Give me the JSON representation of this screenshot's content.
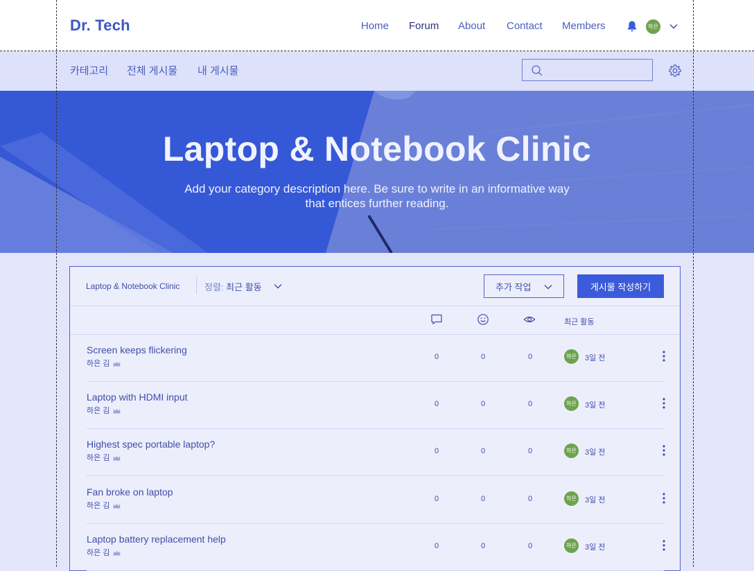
{
  "header": {
    "logo": "Dr. Tech",
    "nav": [
      "Home",
      "Forum",
      "About",
      "Contact",
      "Members"
    ],
    "avatar_text": "하은",
    "icons": [
      "bell-icon",
      "chevron-down-icon"
    ]
  },
  "subnav": {
    "items": [
      "카테고리",
      "전체 게시물",
      "내 게시물"
    ],
    "search_placeholder": ""
  },
  "hero": {
    "title": "Laptop & Notebook Clinic",
    "description_line1": "Add your category description here. Be sure to write in an informative way",
    "description_line2": "that entices further reading."
  },
  "toolbar": {
    "breadcrumb": "Laptop & Notebook Clinic",
    "sort_label": "정렬:",
    "sort_value": "최근 활동",
    "more_actions": "추가 작업",
    "new_post": "게시물 작성하기"
  },
  "columns": {
    "icons": [
      "comment-icon",
      "like-icon",
      "view-icon"
    ],
    "recent": "최근 활동"
  },
  "posts": [
    {
      "title": "Screen keeps flickering",
      "author": "하은 김",
      "comments": "0",
      "likes": "0",
      "views": "0",
      "avatar": "하은",
      "time": "3일 전"
    },
    {
      "title": "Laptop with HDMI input",
      "author": "하은 김",
      "comments": "0",
      "likes": "0",
      "views": "0",
      "avatar": "하은",
      "time": "3일 전"
    },
    {
      "title": "Highest spec portable laptop?",
      "author": "하은 김",
      "comments": "0",
      "likes": "0",
      "views": "0",
      "avatar": "하은",
      "time": "3일 전"
    },
    {
      "title": "Fan broke on laptop",
      "author": "하은 김",
      "comments": "0",
      "likes": "0",
      "views": "0",
      "avatar": "하은",
      "time": "3일 전"
    },
    {
      "title": "Laptop battery replacement help",
      "author": "하은 김",
      "comments": "0",
      "likes": "0",
      "views": "0",
      "avatar": "하은",
      "time": "3일 전"
    }
  ],
  "colors": {
    "accent": "#3b5bdb",
    "text": "#3d4fa8",
    "avatar": "#6ea34e",
    "hero": "#3c5fd9"
  }
}
